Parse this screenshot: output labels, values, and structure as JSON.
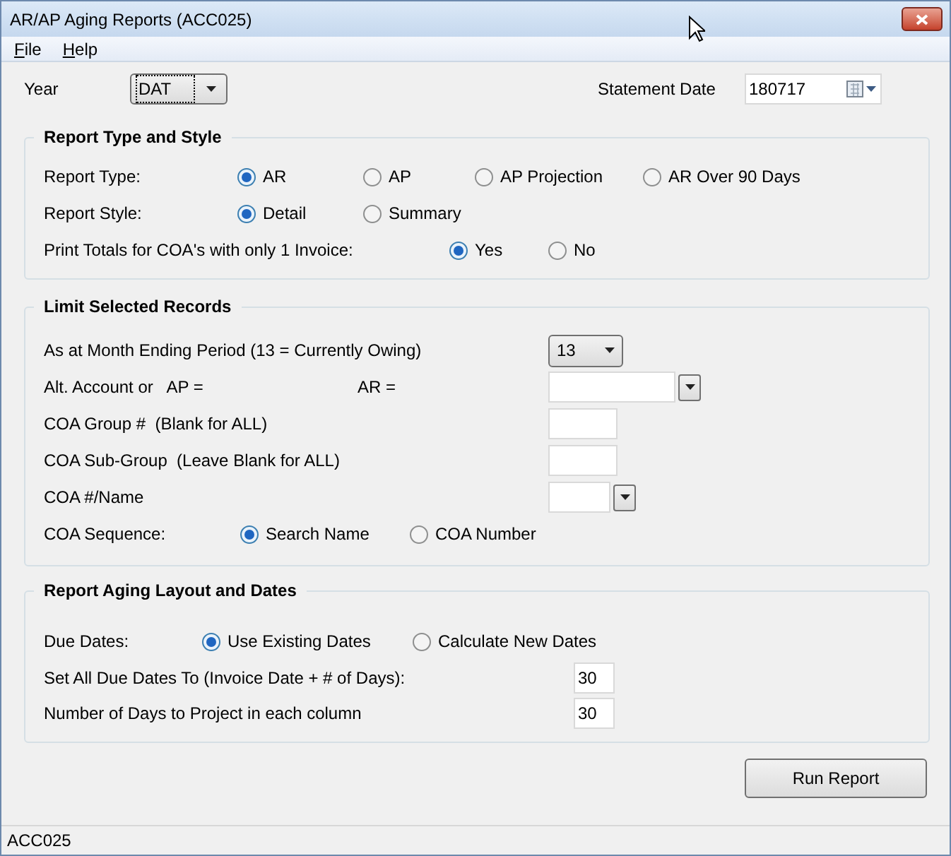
{
  "window": {
    "title": "AR/AP Aging Reports (ACC025)"
  },
  "menu": [
    {
      "label": "File"
    },
    {
      "label": "Help"
    }
  ],
  "year": {
    "label": "Year",
    "value": "DAT"
  },
  "statement_date": {
    "label": "Statement Date",
    "value": "180717"
  },
  "report_type_and_style": {
    "title": "Report Type and Style",
    "report_type": {
      "label": "Report Type:",
      "options": [
        {
          "label": "AR",
          "selected": true
        },
        {
          "label": "AP",
          "selected": false
        },
        {
          "label": "AP Projection",
          "selected": false
        },
        {
          "label": "AR Over 90 Days",
          "selected": false
        }
      ]
    },
    "report_style": {
      "label": "Report Style:",
      "options": [
        {
          "label": "Detail",
          "selected": true
        },
        {
          "label": "Summary",
          "selected": false
        }
      ]
    },
    "print_totals": {
      "label": "Print Totals for COA's with only 1 Invoice:",
      "options": [
        {
          "label": "Yes",
          "selected": true
        },
        {
          "label": "No",
          "selected": false
        }
      ]
    }
  },
  "limit_selected_records": {
    "title": "Limit Selected Records",
    "month_period": {
      "label": "As at Month Ending Period (13 = Currently Owing)",
      "value": "13"
    },
    "alt_account": {
      "label": "Alt. Account or   AP =",
      "ar_label": "AR ="
    },
    "coa_group": {
      "label": "COA Group #  (Blank for ALL)"
    },
    "coa_sub_group": {
      "label": "COA Sub-Group  (Leave Blank for ALL)"
    },
    "coa_name": {
      "label": "COA #/Name"
    },
    "coa_sequence": {
      "label": "COA Sequence:",
      "options": [
        {
          "label": "Search Name",
          "selected": true
        },
        {
          "label": "COA Number",
          "selected": false
        }
      ]
    }
  },
  "aging_layout": {
    "title": "Report Aging Layout and Dates",
    "due_dates": {
      "label": "Due Dates:",
      "options": [
        {
          "label": "Use Existing Dates",
          "selected": true
        },
        {
          "label": "Calculate New Dates",
          "selected": false
        }
      ]
    },
    "set_all_due_dates": {
      "label": "Set All Due Dates To (Invoice Date + # of Days):",
      "value": "30"
    },
    "days_to_project": {
      "label": "Number of Days to Project in each column",
      "value": "30"
    }
  },
  "run_button": {
    "label": "Run Report"
  },
  "status_bar": {
    "text": "ACC025"
  }
}
